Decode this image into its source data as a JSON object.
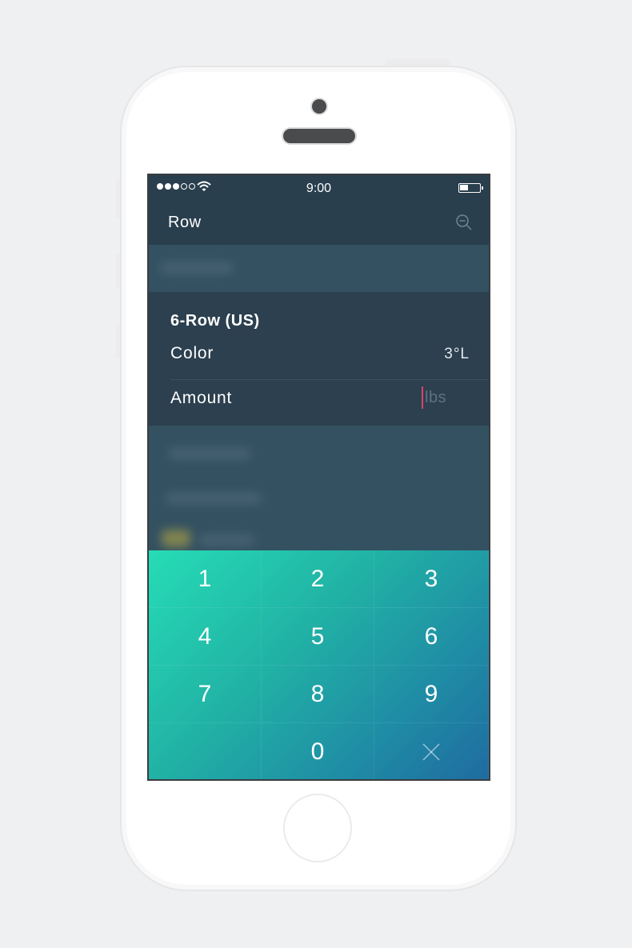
{
  "status_bar": {
    "time": "9:00",
    "signal_icon": "signal-dots-icon",
    "wifi_icon": "wifi-icon",
    "battery_icon": "battery-icon",
    "battery_level": 0.45
  },
  "nav": {
    "title": "Row",
    "search_icon": "zoom-out-icon"
  },
  "detail": {
    "title": "6-Row (US)",
    "color_label": "Color",
    "color_value": "3°L",
    "amount_label": "Amount",
    "amount_placeholder": "lbs"
  },
  "keypad": {
    "keys": [
      "1",
      "2",
      "3",
      "4",
      "5",
      "6",
      "7",
      "8",
      "9",
      "",
      "0"
    ],
    "delete_icon": "close-icon"
  },
  "colors": {
    "screen_bg": "#2a3f4e",
    "keypad_start": "#26dcb6",
    "keypad_end": "#1f6ba0",
    "cursor": "#e0406a"
  }
}
